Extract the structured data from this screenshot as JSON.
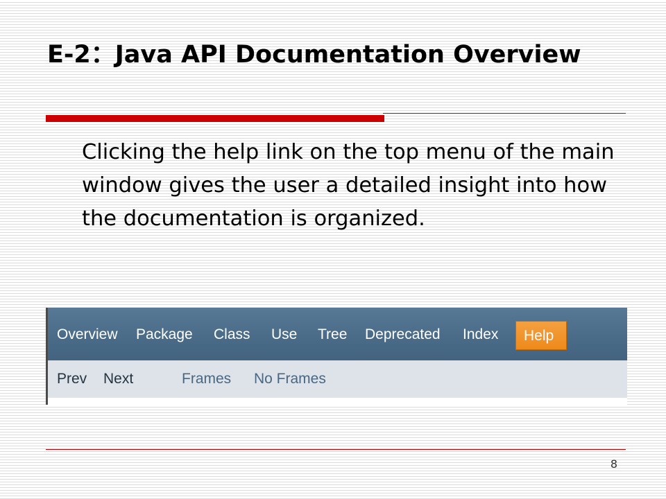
{
  "slide": {
    "title": "E-2：Java API Documentation Overview",
    "body": "Clicking the help link on the top menu of the main window gives the user a detailed insight into how the documentation is organized.",
    "page_number": "8"
  },
  "screenshot": {
    "top_nav": [
      "Overview",
      "Package",
      "Class",
      "Use",
      "Tree",
      "Deprecated",
      "Index"
    ],
    "top_nav_active": "Help",
    "sub_nav": [
      "Prev",
      "Next",
      "Frames",
      "No Frames"
    ]
  },
  "colors": {
    "accent_red": "#cc0000",
    "nav_bar": "#4a6c89",
    "help_highlight": "#ee8a1a",
    "sub_nav_bar": "#dee3e9"
  }
}
